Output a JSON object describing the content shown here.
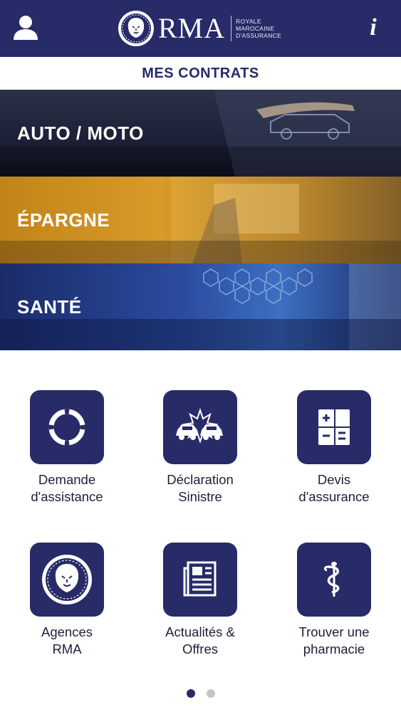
{
  "colors": {
    "navy": "#272b68",
    "banner_epargne": "#d99a2a",
    "dot_active": "#272b68",
    "dot_inactive": "#c4c4c4"
  },
  "header": {
    "user_icon": "person-icon",
    "info_icon": "info-icon",
    "info_label": "i",
    "logo": {
      "name": "RMA",
      "sub_line1": "ROYALE",
      "sub_line2": "MAROCAINE",
      "sub_line3": "D'ASSURANCE"
    }
  },
  "section_title": "MES CONTRATS",
  "banners": [
    {
      "label": "AUTO / MOTO"
    },
    {
      "label": "ÉPARGNE"
    },
    {
      "label": "SANTÉ"
    }
  ],
  "tiles": [
    {
      "line1": "Demande",
      "line2": "d'assistance",
      "icon": "lifebuoy-icon"
    },
    {
      "line1": "Déclaration",
      "line2": "Sinistre",
      "icon": "car-crash-icon"
    },
    {
      "line1": "Devis",
      "line2": "d'assurance",
      "icon": "calculator-icon"
    },
    {
      "line1": "Agences",
      "line2": "RMA",
      "icon": "rma-lion-seal-icon"
    },
    {
      "line1": "Actualités &",
      "line2": "Offres",
      "icon": "newspaper-icon"
    },
    {
      "line1": "Trouver une",
      "line2": "pharmacie",
      "icon": "pharmacy-caduceus-icon"
    }
  ],
  "pager": {
    "pages": 2,
    "current": 1
  }
}
